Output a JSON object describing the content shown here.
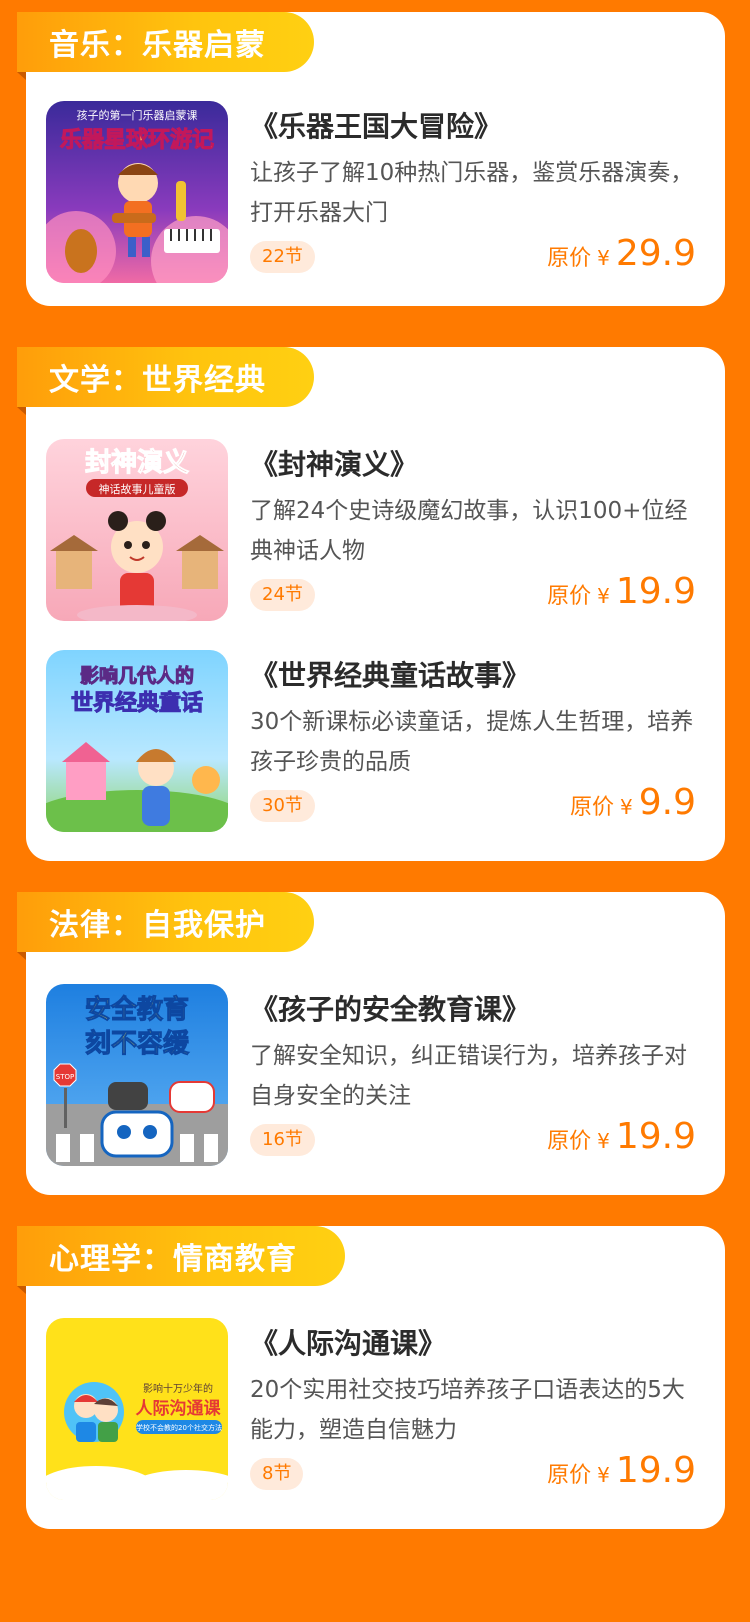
{
  "sections": [
    {
      "title": "音乐：乐器启蒙",
      "courses": [
        {
          "title": "《乐器王国大冒险》",
          "desc": "让孩子了解10种热门乐器，鉴赏乐器演奏，打开乐器大门",
          "lessons": "22节",
          "price_label": "原价",
          "currency": "¥",
          "price": "29.9",
          "cover_top": "孩子的第一门乐器启蒙课",
          "cover_title": "乐器星球环游记"
        }
      ]
    },
    {
      "title": "文学：世界经典",
      "courses": [
        {
          "title": "《封神演义》",
          "desc": "了解24个史诗级魔幻故事，认识100+位经典神话人物",
          "lessons": "24节",
          "price_label": "原价",
          "currency": "¥",
          "price": "19.9",
          "cover_title": "封神演义",
          "cover_sub": "神话故事儿童版"
        },
        {
          "title": "《世界经典童话故事》",
          "desc": "30个新课标必读童话，提炼人生哲理，培养孩子珍贵的品质",
          "lessons": "30节",
          "price_label": "原价",
          "currency": "¥",
          "price": "9.9",
          "cover_line1": "影响几代人的",
          "cover_line2": "世界经典童话"
        }
      ]
    },
    {
      "title": "法律：自我保护",
      "courses": [
        {
          "title": "《孩子的安全教育课》",
          "desc": "了解安全知识，纠正错误行为，培养孩子对自身安全的关注",
          "lessons": "16节",
          "price_label": "原价",
          "currency": "¥",
          "price": "19.9",
          "cover_line1": "安全教育",
          "cover_line2": "刻不容缓",
          "cover_sign": "STOP"
        }
      ]
    },
    {
      "title": "心理学：情商教育",
      "courses": [
        {
          "title": "《人际沟通课》",
          "desc": "20个实用社交技巧培养孩子口语表达的5大能力，塑造自信魅力",
          "lessons": "8节",
          "price_label": "原价",
          "currency": "¥",
          "price": "19.9",
          "cover_top": "影响十万少年的",
          "cover_title": "人际沟通课",
          "cover_sub": "学校不会教的20个社交方法"
        }
      ]
    }
  ],
  "colors": {
    "background": "#ff7a00",
    "accent": "#ff7a00",
    "tab_gradient_start": "#ff9d0a",
    "tab_gradient_end": "#ffd012",
    "badge_bg": "#ffeadb"
  }
}
